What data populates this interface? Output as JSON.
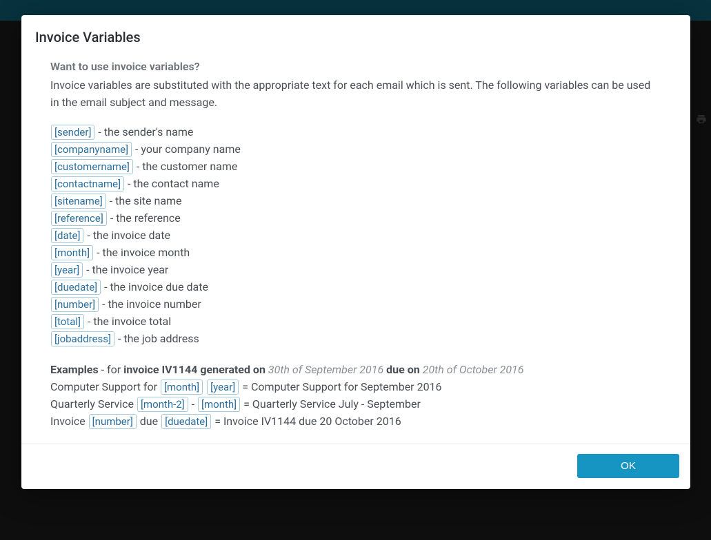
{
  "modal": {
    "title": "Invoice Variables",
    "lead": "Want to use invoice variables?",
    "intro": "Invoice variables are substituted with the appropriate text for each email which is sent. The following variables can be used in the email subject and message."
  },
  "variables": [
    {
      "token": "sender",
      "desc": "the sender's name"
    },
    {
      "token": "companyname",
      "desc": "your company name"
    },
    {
      "token": "customername",
      "desc": "the customer name"
    },
    {
      "token": "contactname",
      "desc": "the contact name"
    },
    {
      "token": "sitename",
      "desc": "the site name"
    },
    {
      "token": "reference",
      "desc": "the reference"
    },
    {
      "token": "date",
      "desc": "the invoice date"
    },
    {
      "token": "month",
      "desc": "the invoice month"
    },
    {
      "token": "year",
      "desc": "the invoice year"
    },
    {
      "token": "duedate",
      "desc": "the invoice due date"
    },
    {
      "token": "number",
      "desc": "the invoice number"
    },
    {
      "token": "total",
      "desc": "the invoice total"
    },
    {
      "token": "jobaddress",
      "desc": "the job address"
    }
  ],
  "examples": {
    "label": "Examples",
    "header_pre": " - for ",
    "header_invoice_prefix": "invoice ",
    "header_invoice_number": "IV1144",
    "header_generated": " generated on ",
    "header_gen_date": "30th of September 2016",
    "header_due": " due on ",
    "header_due_date": "20th of October 2016",
    "line1_prefix": "Computer Support for ",
    "line1_token1": "month",
    "line1_token2": "year",
    "line1_result": " = Computer Support for September 2016",
    "line2_prefix": "Quarterly Service ",
    "line2_token1": "month-2",
    "line2_sep": " - ",
    "line2_token2": "month",
    "line2_result": " = Quarterly Service July - September",
    "line3_prefix": "Invoice ",
    "line3_token1": "number",
    "line3_mid": " due ",
    "line3_token2": "duedate",
    "line3_result": " = Invoice IV1144 due 20 October 2016"
  },
  "footer": {
    "ok": "OK"
  }
}
